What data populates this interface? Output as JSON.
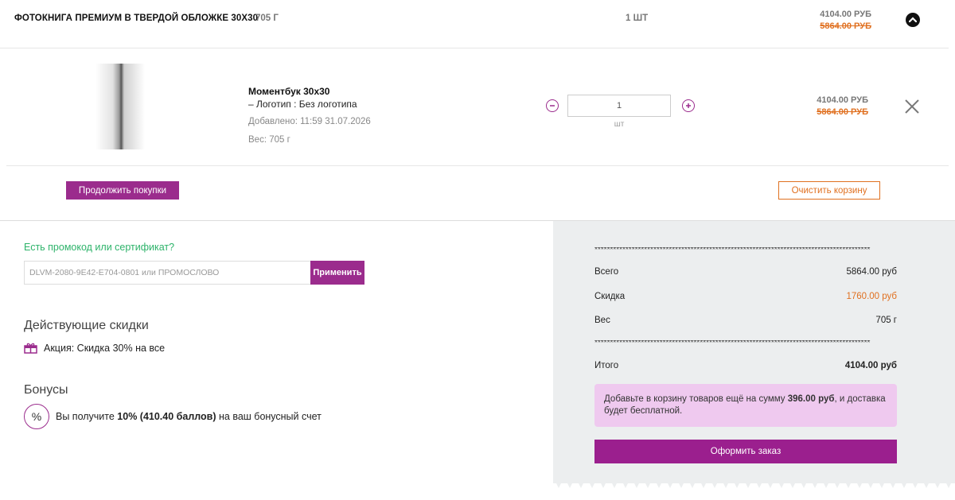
{
  "header": {
    "title": "ФОТОКНИГА ПРЕМИУМ В ТВЕРДОЙ ОБЛОЖКЕ 30Х30",
    "weight": "705 Г",
    "quantity": "1 ШТ",
    "price_new": "4104.00 РУБ",
    "price_old": "5864.00 РУБ"
  },
  "product": {
    "name": "Моментбук 30х30",
    "option": "– Логотип : Без логотипа",
    "added": "Добавлено: 11:59 31.07.2026",
    "weight": "Вес: 705 г",
    "quantity_value": "1",
    "quantity_unit": "шт",
    "price_new": "4104.00 РУБ",
    "price_old": "5864.00 РУБ"
  },
  "actions": {
    "continue_label": "Продолжить покупки",
    "clear_label": "Очистить корзину"
  },
  "promo": {
    "link": "Есть промокод или сертификат?",
    "placeholder": "DLVM-2080-9E42-E704-0801 или ПРОМОСЛОВО",
    "apply_label": "Применить"
  },
  "discounts": {
    "title": "Действующие скидки",
    "item": "Акция: Скидка 30% на все"
  },
  "bonuses": {
    "title": "Бонусы",
    "icon_text": "%",
    "text_before": "Вы получите ",
    "text_bold": "10% (410.40 баллов)",
    "text_after": " на ваш бонусный счет"
  },
  "summary": {
    "dots": "*****************************************************************************************",
    "total_label": "Всего",
    "total_value": "5864.00 руб",
    "discount_label": "Скидка",
    "discount_value": "1760.00 руб",
    "weight_label": "Вес",
    "weight_value": "705 г",
    "final_label": "Итого",
    "final_value": "4104.00 руб",
    "notice_before": "Добавьте в корзину товаров ещё на сумму ",
    "notice_bold": "396.00 руб",
    "notice_after": ", и доставка будет бесплатной.",
    "order_label": "Оформить заказ"
  },
  "colors": {
    "accent": "#9b2c8d",
    "orange": "#e07020",
    "green": "#2db36a",
    "receipt_bg": "#eceeef",
    "notice_bg": "#efc9ef"
  }
}
